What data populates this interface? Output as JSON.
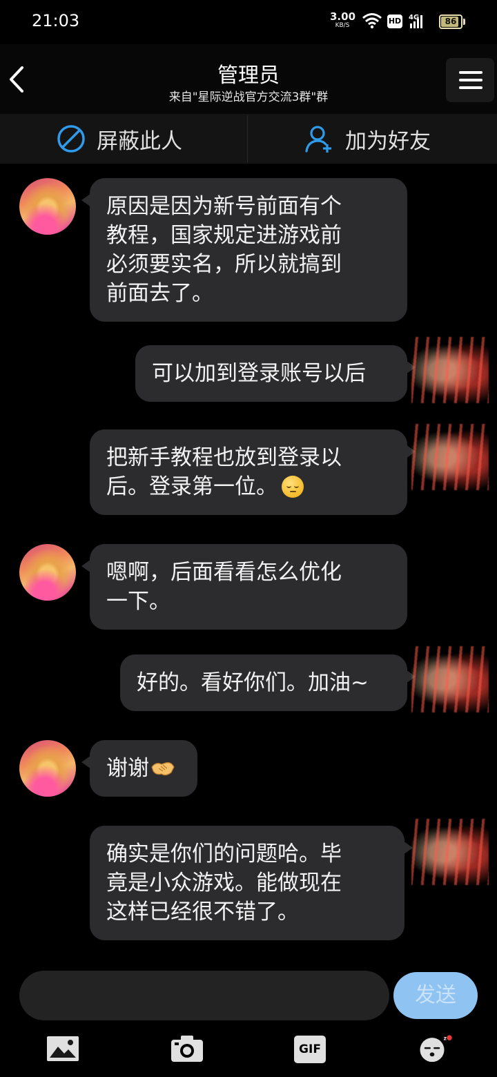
{
  "status_bar": {
    "time": "21:03",
    "net_speed_value": "3.00",
    "net_speed_unit": "KB/S",
    "hd_badge": "HD",
    "network_type": "4G",
    "battery_level": "86"
  },
  "header": {
    "title": "管理员",
    "subtitle": "来自\"星际逆战官方交流3群\"群",
    "back_icon": "chevron-left-icon",
    "menu_icon": "hamburger-menu-icon"
  },
  "actions": {
    "block_label": "屏蔽此人",
    "add_friend_label": "加为好友",
    "block_icon": "block-icon",
    "add_friend_icon": "add-user-icon"
  },
  "messages": [
    {
      "side": "left",
      "lines": [
        "原因是因为新号前面有个",
        "教程，国家规定进游戏前",
        "必须要实名，所以就搞到",
        "前面去了。"
      ]
    },
    {
      "side": "right",
      "lines": [
        "可以加到登录账号以后"
      ]
    },
    {
      "side": "right",
      "lines": [
        "把新手教程也放到登录以",
        "后。登录第一位。"
      ],
      "emoji": "pensive-face-emoji"
    },
    {
      "side": "left",
      "lines": [
        "嗯啊，后面看看怎么优化",
        "一下。"
      ]
    },
    {
      "side": "right",
      "lines": [
        "好的。看好你们。加油~"
      ]
    },
    {
      "side": "left",
      "lines": [
        "谢谢"
      ],
      "emoji": "handshake-emoji"
    },
    {
      "side": "right",
      "lines": [
        "确实是你们的问题哈。毕",
        "竟是小众游戏。能做现在",
        "这样已经很不错了。"
      ]
    }
  ],
  "input": {
    "placeholder": "",
    "send_label": "发送"
  },
  "toolbar": {
    "image_icon": "image-icon",
    "camera_icon": "camera-icon",
    "gif_label": "GIF",
    "emoji_icon": "emoji-sleepy-icon"
  },
  "colors": {
    "background": "#000000",
    "bubble": "#2c2c2e",
    "accent_blue": "#2f9bea",
    "send_button": "#8fc3f2"
  }
}
